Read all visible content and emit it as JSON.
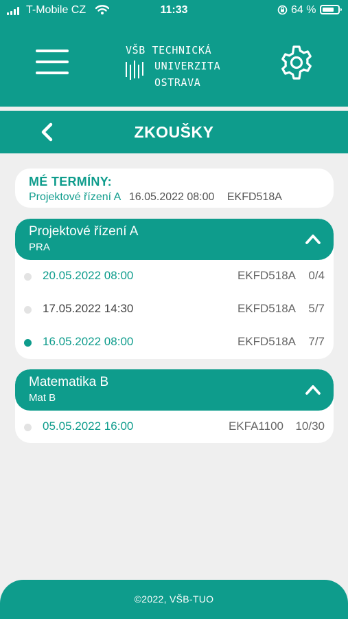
{
  "status_bar": {
    "carrier": "T-Mobile CZ",
    "time": "11:33",
    "battery_percent": "64 %"
  },
  "header": {
    "logo_line1": "VŠB TECHNICKÁ",
    "logo_line2": "UNIVERZITA",
    "logo_line3": "OSTRAVA",
    "menu_icon": "hamburger-icon",
    "settings_icon": "gear-icon"
  },
  "nav": {
    "back_icon": "back-arrow-icon",
    "title": "ZKOUŠKY"
  },
  "my_terms": {
    "heading": "MÉ TERMÍNY:",
    "subject": "Projektové řízení A",
    "datetime": "16.05.2022 08:00",
    "code": "EKFD518A"
  },
  "subjects": [
    {
      "name": "Projektové řízení A",
      "abbr": "PRA",
      "terms": [
        {
          "datetime": "20.05.2022 08:00",
          "code": "EKFD518A",
          "capacity": "0/4",
          "selected": false
        },
        {
          "datetime": "17.05.2022 14:30",
          "code": "EKFD518A",
          "capacity": "5/7",
          "selected": false
        },
        {
          "datetime": "16.05.2022 08:00",
          "code": "EKFD518A",
          "capacity": "7/7",
          "selected": true
        }
      ]
    },
    {
      "name": "Matematika B",
      "abbr": "Mat B",
      "terms": [
        {
          "datetime": "05.05.2022 16:00",
          "code": "EKFA1100",
          "capacity": "10/30",
          "selected": false
        }
      ]
    }
  ],
  "footer": {
    "text": "©2022, VŠB-TUO"
  },
  "colors": {
    "accent": "#0e9c8c",
    "background": "#efefef"
  }
}
